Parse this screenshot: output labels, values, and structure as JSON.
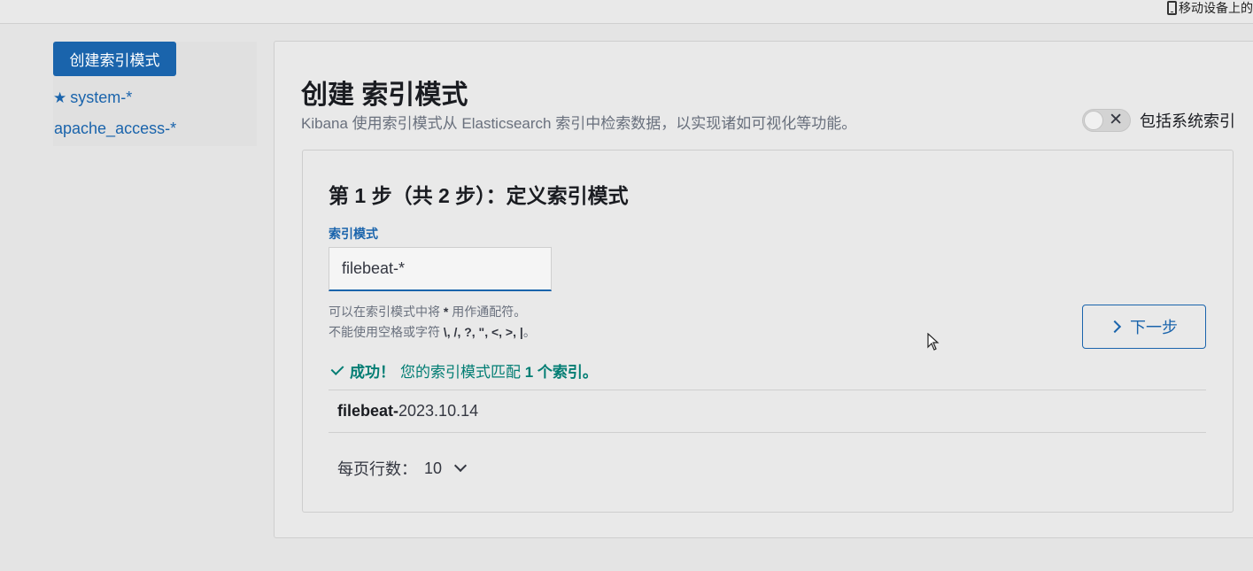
{
  "topbar": {
    "mobile_link": "移动设备上的"
  },
  "sidebar": {
    "create_button": "创建索引模式",
    "items": [
      {
        "label": "system-*",
        "icon": "star-icon",
        "default": true
      },
      {
        "label": "apache_access-*"
      }
    ]
  },
  "header": {
    "title": "创建 索引模式",
    "description": "Kibana 使用索引模式从 Elasticsearch 索引中检索数据，以实现诸如可视化等功能。",
    "toggle_label": "包括系统索引",
    "toggle_on": false
  },
  "step": {
    "title": "第 1 步（共 2 步）：定义索引模式",
    "field_label": "索引模式",
    "input_value": "filebeat-*",
    "help_line1_prefix": "可以在索引模式中将 ",
    "help_line1_bold": "*",
    "help_line1_suffix": " 用作通配符。",
    "help_line2_prefix": "不能使用空格或字符 ",
    "help_line2_bold": "\\, /, ?, \", <, >, |",
    "help_line2_suffix": "。",
    "next_button": "下一步",
    "success_bold": "成功！",
    "success_text": " 您的索引模式匹配 ",
    "success_count": "1 个索引。",
    "results": [
      {
        "bold": "filebeat-",
        "rest": "2023.10.14"
      }
    ],
    "rows_per_page_label": "每页行数：",
    "rows_per_page_value": "10"
  },
  "colors": {
    "primary": "#1a64ac",
    "success": "#017d73",
    "subdued_text": "#69707d"
  }
}
